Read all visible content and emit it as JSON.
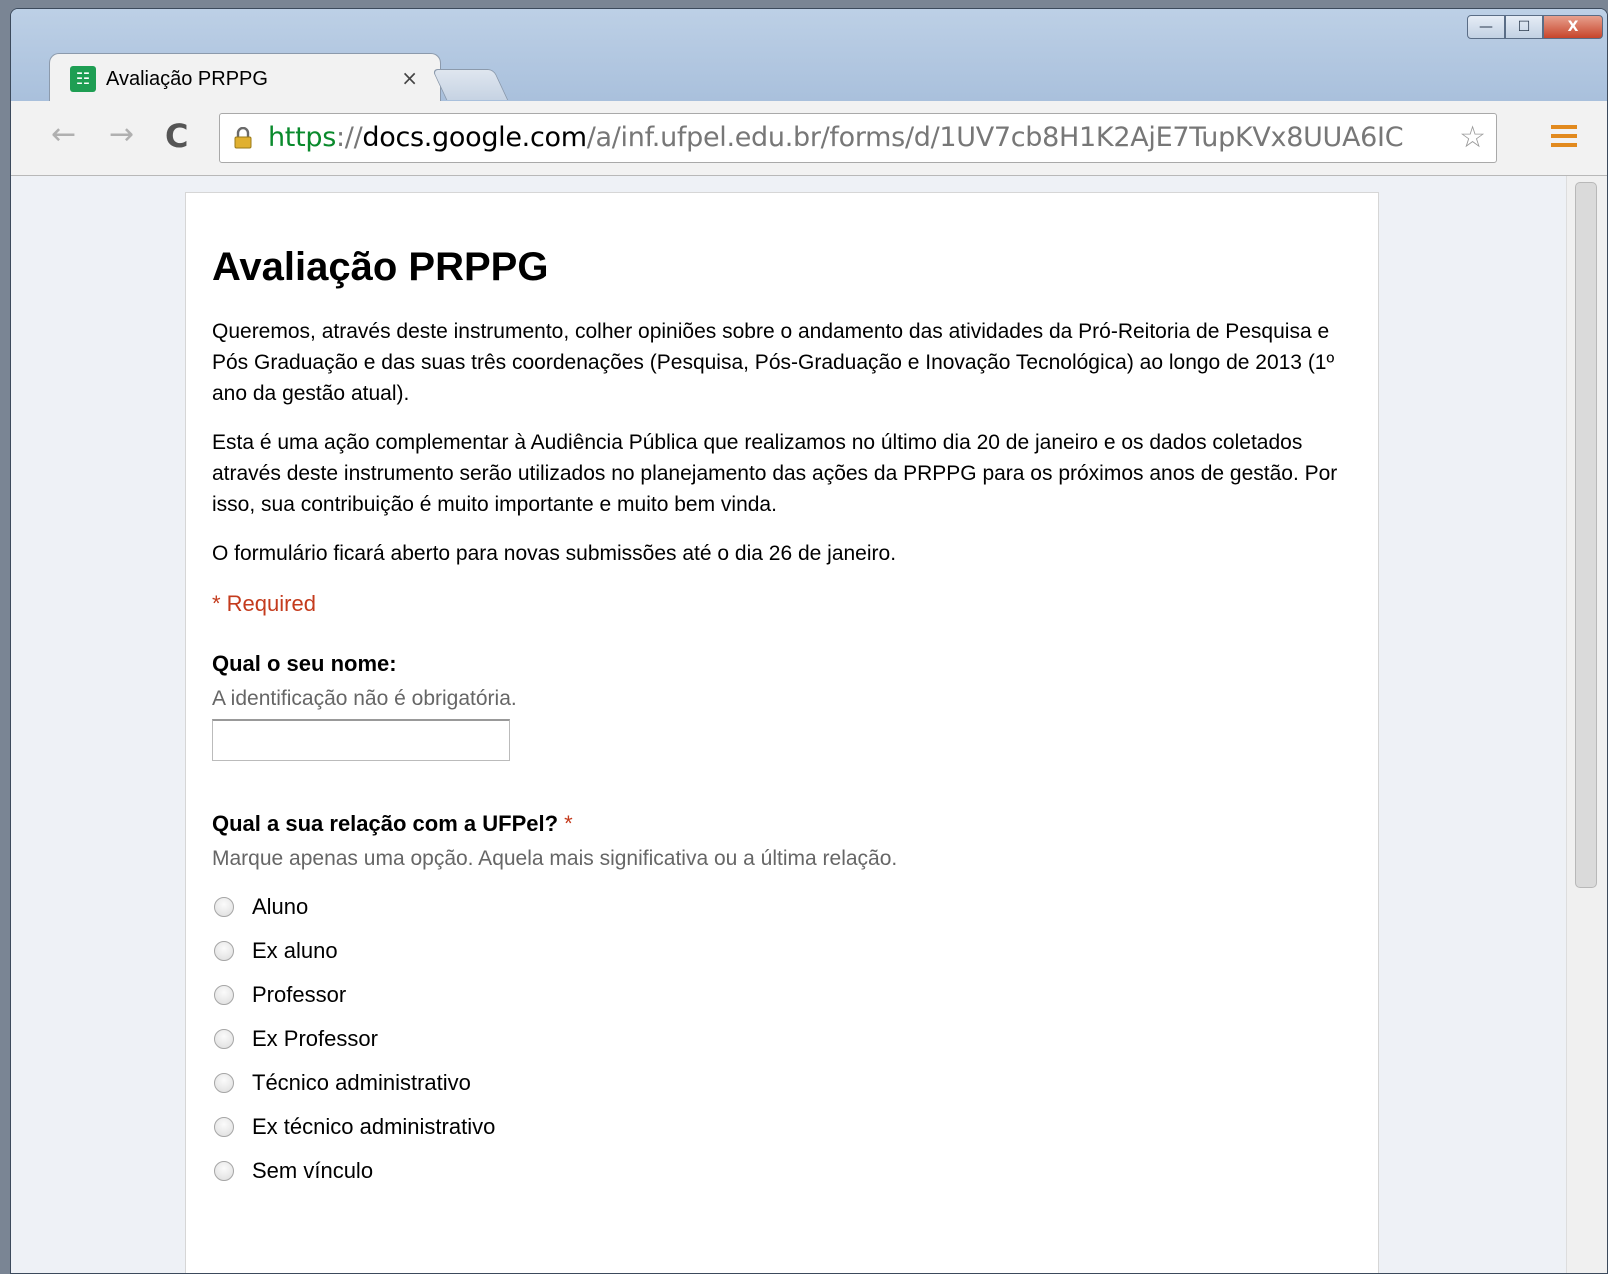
{
  "window": {
    "controls": {
      "minimize": "—",
      "maximize": "☐",
      "close": "X"
    }
  },
  "tab": {
    "favicon": "☷",
    "title": "Avaliação PRPPG",
    "close": "×"
  },
  "toolbar": {
    "back": "←",
    "forward": "→",
    "reload": "C",
    "url_scheme": "https",
    "url_sep": "://",
    "url_host": "docs.google.com",
    "url_path": "/a/inf.ufpel.edu.br/forms/d/1UV7cb8H1K2AjE7TupKVx8UUA6IC",
    "bookmark_star": "☆"
  },
  "form": {
    "title": "Avaliação PRPPG",
    "description": [
      "Queremos, através deste instrumento, colher opiniões sobre o andamento das atividades da Pró-Reitoria de Pesquisa e Pós Graduação e das suas três coordenações (Pesquisa, Pós-Graduação e Inovação Tecnológica) ao longo de 2013 (1º ano da gestão atual).",
      "Esta é uma ação complementar à Audiência Pública que realizamos no último dia 20 de janeiro e os dados coletados através deste instrumento serão utilizados no planejamento das ações da PRPPG para os próximos anos de gestão. Por isso, sua contribuição é muito importante e muito bem vinda.",
      "O formulário ficará aberto para novas submissões até o dia 26 de janeiro."
    ],
    "required_note": "* Required",
    "q1": {
      "title": "Qual o seu nome:",
      "help": "A identificação não é obrigatória.",
      "value": ""
    },
    "q2": {
      "title": "Qual a sua relação com a UFPel?",
      "required_mark": "*",
      "help": "Marque apenas uma opção. Aquela mais significativa ou a última relação.",
      "options": [
        "Aluno",
        "Ex aluno",
        "Professor",
        "Ex Professor",
        "Técnico administrativo",
        "Ex técnico administrativo",
        "Sem vínculo"
      ]
    }
  }
}
